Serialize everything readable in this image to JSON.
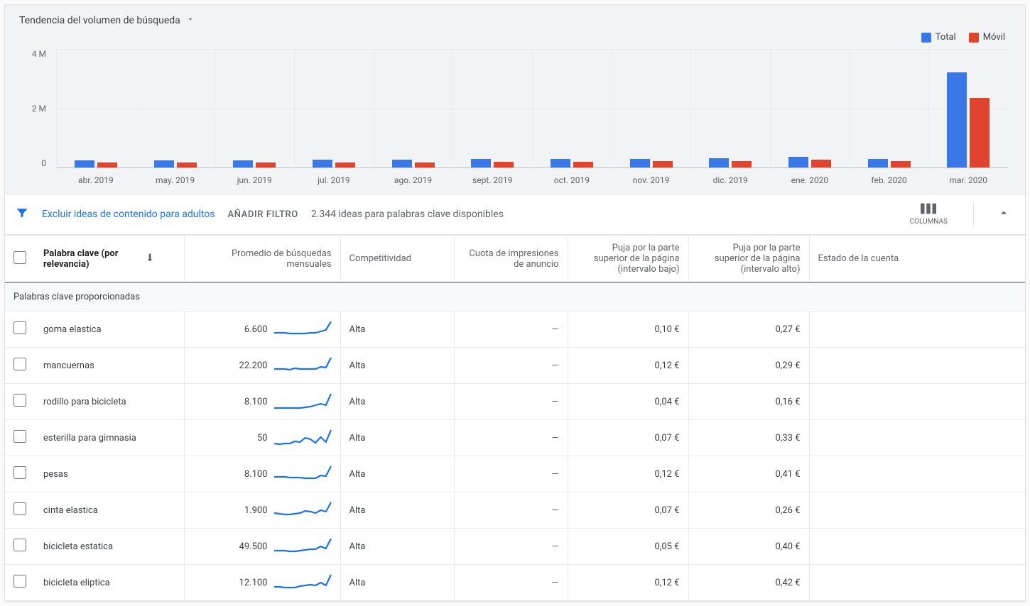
{
  "chart": {
    "title": "Tendencia del volumen de búsqueda",
    "legend": {
      "total": "Total",
      "mobile": "Móvil"
    },
    "colors": {
      "total": "#3b78e7",
      "mobile": "#e0442f"
    },
    "ylabels": [
      "4 M",
      "2 M",
      "0"
    ]
  },
  "chart_data": {
    "type": "bar",
    "categories": [
      "abr. 2019",
      "may. 2019",
      "jun. 2019",
      "jul. 2019",
      "ago. 2019",
      "sept. 2019",
      "oct. 2019",
      "nov. 2019",
      "dic. 2019",
      "ene. 2020",
      "feb. 2020",
      "mar. 2020"
    ],
    "series": [
      {
        "name": "Total",
        "values": [
          250000,
          250000,
          230000,
          260000,
          260000,
          280000,
          280000,
          290000,
          300000,
          360000,
          290000,
          3200000
        ]
      },
      {
        "name": "Móvil",
        "values": [
          170000,
          170000,
          160000,
          180000,
          180000,
          200000,
          200000,
          210000,
          220000,
          260000,
          210000,
          2350000
        ]
      }
    ],
    "ylim": [
      0,
      4000000
    ],
    "ylabel": "",
    "xlabel": "",
    "title": "Tendencia del volumen de búsqueda"
  },
  "filters": {
    "exclude_adult": "Excluir ideas de contenido para adultos",
    "add_filter": "AÑADIR FILTRO",
    "ideas_available": "2.344 ideas para palabras clave disponibles",
    "columns_label": "COLUMNAS"
  },
  "columns": {
    "keyword": "Palabra clave (por relevancia)",
    "avg_searches": "Promedio de búsquedas mensuales",
    "competition": "Competitividad",
    "impression_share": "Cuota de impresiones de anuncio",
    "bid_low": "Puja por la parte superior de la página (intervalo bajo)",
    "bid_high": "Puja por la parte superior de la página (intervalo alto)",
    "account_status": "Estado de la cuenta"
  },
  "section_label": "Palabras clave proporcionadas",
  "dash": "—",
  "rows": [
    {
      "keyword": "goma elastica",
      "avg": "6.600",
      "spark": [
        18,
        18,
        18,
        19,
        19,
        19,
        19,
        18,
        18,
        16,
        14,
        2
      ],
      "competition": "Alta",
      "impr": "—",
      "bid_low": "0,10 €",
      "bid_high": "0,27 €",
      "status": ""
    },
    {
      "keyword": "mancuernas",
      "avg": "22.200",
      "spark": [
        18,
        18,
        18,
        19,
        17,
        18,
        18,
        18,
        18,
        15,
        16,
        2
      ],
      "competition": "Alta",
      "impr": "—",
      "bid_low": "0,12 €",
      "bid_high": "0,29 €",
      "status": ""
    },
    {
      "keyword": "rodillo para bicicleta",
      "avg": "8.100",
      "spark": [
        22,
        22,
        22,
        22,
        22,
        22,
        21,
        20,
        18,
        16,
        18,
        2
      ],
      "competition": "Alta",
      "impr": "—",
      "bid_low": "0,04 €",
      "bid_high": "0,16 €",
      "status": ""
    },
    {
      "keyword": "esterilla para gimnasia",
      "avg": "50",
      "spark": [
        21,
        22,
        21,
        21,
        18,
        19,
        13,
        15,
        20,
        12,
        19,
        2
      ],
      "competition": "Alta",
      "impr": "—",
      "bid_low": "0,07 €",
      "bid_high": "0,33 €",
      "status": ""
    },
    {
      "keyword": "pesas",
      "avg": "8.100",
      "spark": [
        17,
        17,
        17,
        18,
        18,
        18,
        19,
        19,
        19,
        15,
        16,
        2
      ],
      "competition": "Alta",
      "impr": "—",
      "bid_low": "0,12 €",
      "bid_high": "0,41 €",
      "status": ""
    },
    {
      "keyword": "cinta elastica",
      "avg": "1.900",
      "spark": [
        17,
        18,
        19,
        19,
        18,
        17,
        14,
        15,
        17,
        13,
        15,
        2
      ],
      "competition": "Alta",
      "impr": "—",
      "bid_low": "0,07 €",
      "bid_high": "0,26 €",
      "status": ""
    },
    {
      "keyword": "bicicleta estatica",
      "avg": "49.500",
      "spark": [
        19,
        19,
        19,
        20,
        20,
        19,
        18,
        17,
        17,
        13,
        16,
        2
      ],
      "competition": "Alta",
      "impr": "—",
      "bid_low": "0,05 €",
      "bid_high": "0,40 €",
      "status": ""
    },
    {
      "keyword": "bicicleta eliptica",
      "avg": "12.100",
      "spark": [
        19,
        19,
        20,
        20,
        20,
        18,
        17,
        16,
        17,
        13,
        17,
        2
      ],
      "competition": "Alta",
      "impr": "—",
      "bid_low": "0,12 €",
      "bid_high": "0,42 €",
      "status": ""
    }
  ]
}
